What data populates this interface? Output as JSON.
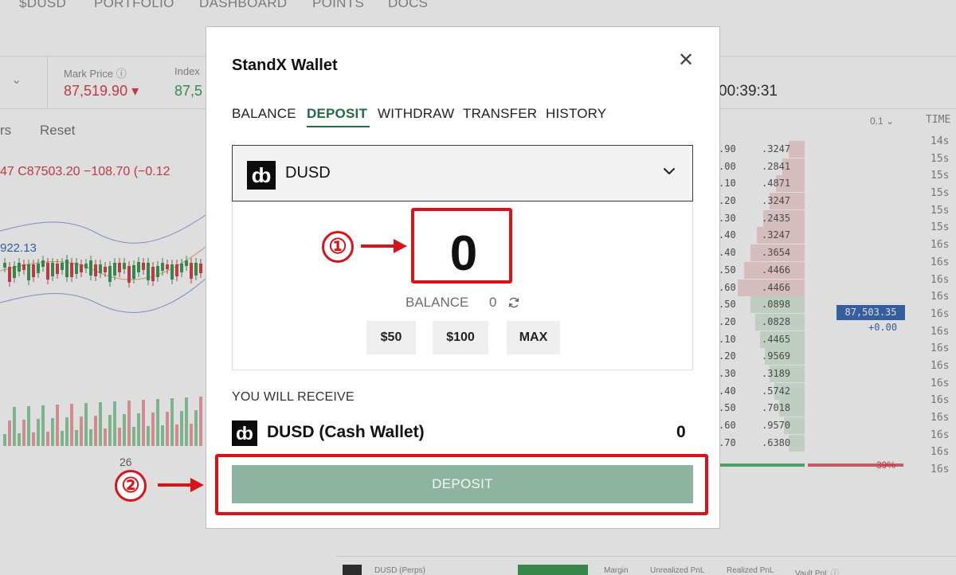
{
  "background": {
    "nav": [
      "$DUSD",
      "PORTFOLIO",
      "DASHBOARD",
      "POINTS",
      "DOCS"
    ],
    "mark_price_label": "Mark Price ⓘ",
    "mark_price_value": "87,519.90 ▾",
    "index_label": "Index",
    "index_value": "87,5",
    "countdown": "00:39:31",
    "toolbar_left": "rs",
    "toolbar_reset": "Reset",
    "ohlc": "47 C87503.20 −108.70 (−0.12",
    "price_tag": "922.13",
    "date_tick": "26",
    "step": "0.1 ⌄",
    "time_header": "TIME",
    "orderbook": [
      {
        "p": ".90",
        "s": ".3247"
      },
      {
        "p": ".00",
        "s": ".2841"
      },
      {
        "p": ".10",
        "s": ".4871"
      },
      {
        "p": ".20",
        "s": ".3247"
      },
      {
        "p": ".30",
        "s": ".2435"
      },
      {
        "p": ".40",
        "s": ".3247"
      },
      {
        "p": ".40",
        "s": ".3654"
      },
      {
        "p": ".50",
        "s": ".4466"
      },
      {
        "p": ".60",
        "s": ".4466"
      },
      {
        "p": ".50",
        "s": ".0898"
      },
      {
        "p": ".20",
        "s": ".0828"
      },
      {
        "p": ".10",
        "s": ".4465"
      },
      {
        "p": ".20",
        "s": ".9569"
      },
      {
        "p": ".30",
        "s": ".3189"
      },
      {
        "p": ".40",
        "s": ".5742"
      },
      {
        "p": ".50",
        "s": ".7018"
      },
      {
        "p": ".60",
        "s": ".9570"
      },
      {
        "p": ".70",
        "s": ".6380"
      }
    ],
    "times": [
      "14s",
      "15s",
      "15s",
      "15s",
      "15s",
      "15s",
      "16s",
      "16s",
      "16s",
      "16s",
      "16s",
      "16s",
      "16s",
      "16s",
      "16s",
      "16s",
      "16s",
      "16s",
      "16s",
      "16s"
    ],
    "mid_price": "87,503.35",
    "mid_delta": "+0.00",
    "sell_pct": "39%",
    "bottom_bar": {
      "asset": "DUSD (Perps)",
      "margin": "Margin",
      "upnl": "Unrealized PnL",
      "rpnl": "Realized PnL",
      "vault": "Vault PnL ⓘ"
    }
  },
  "modal": {
    "title": "StandX Wallet",
    "close_icon": "close-icon",
    "tabs": [
      {
        "label": "BALANCE",
        "active": false
      },
      {
        "label": "DEPOSIT",
        "active": true
      },
      {
        "label": "WITHDRAW",
        "active": false
      },
      {
        "label": "TRANSFER",
        "active": false
      },
      {
        "label": "HISTORY",
        "active": false
      }
    ],
    "token": {
      "logo": "ȸ",
      "name": "DUSD",
      "icon": "chevron-down-icon"
    },
    "amount": "0",
    "balance_label": "BALANCE",
    "balance_value": "0",
    "quick_amounts": [
      "$50",
      "$100",
      "MAX"
    ],
    "receive_label": "YOU WILL RECEIVE",
    "receive_token": "DUSD (Cash Wallet)",
    "receive_amount": "0",
    "deposit_button": "DEPOSIT"
  },
  "annotations": {
    "step1": "①",
    "step2": "②",
    "color": "#d6141a"
  },
  "colors": {
    "accent_green": "#236b47",
    "deposit_button": "#8db4a0",
    "down_red": "#d9434e",
    "up_green": "#3e9b57"
  }
}
